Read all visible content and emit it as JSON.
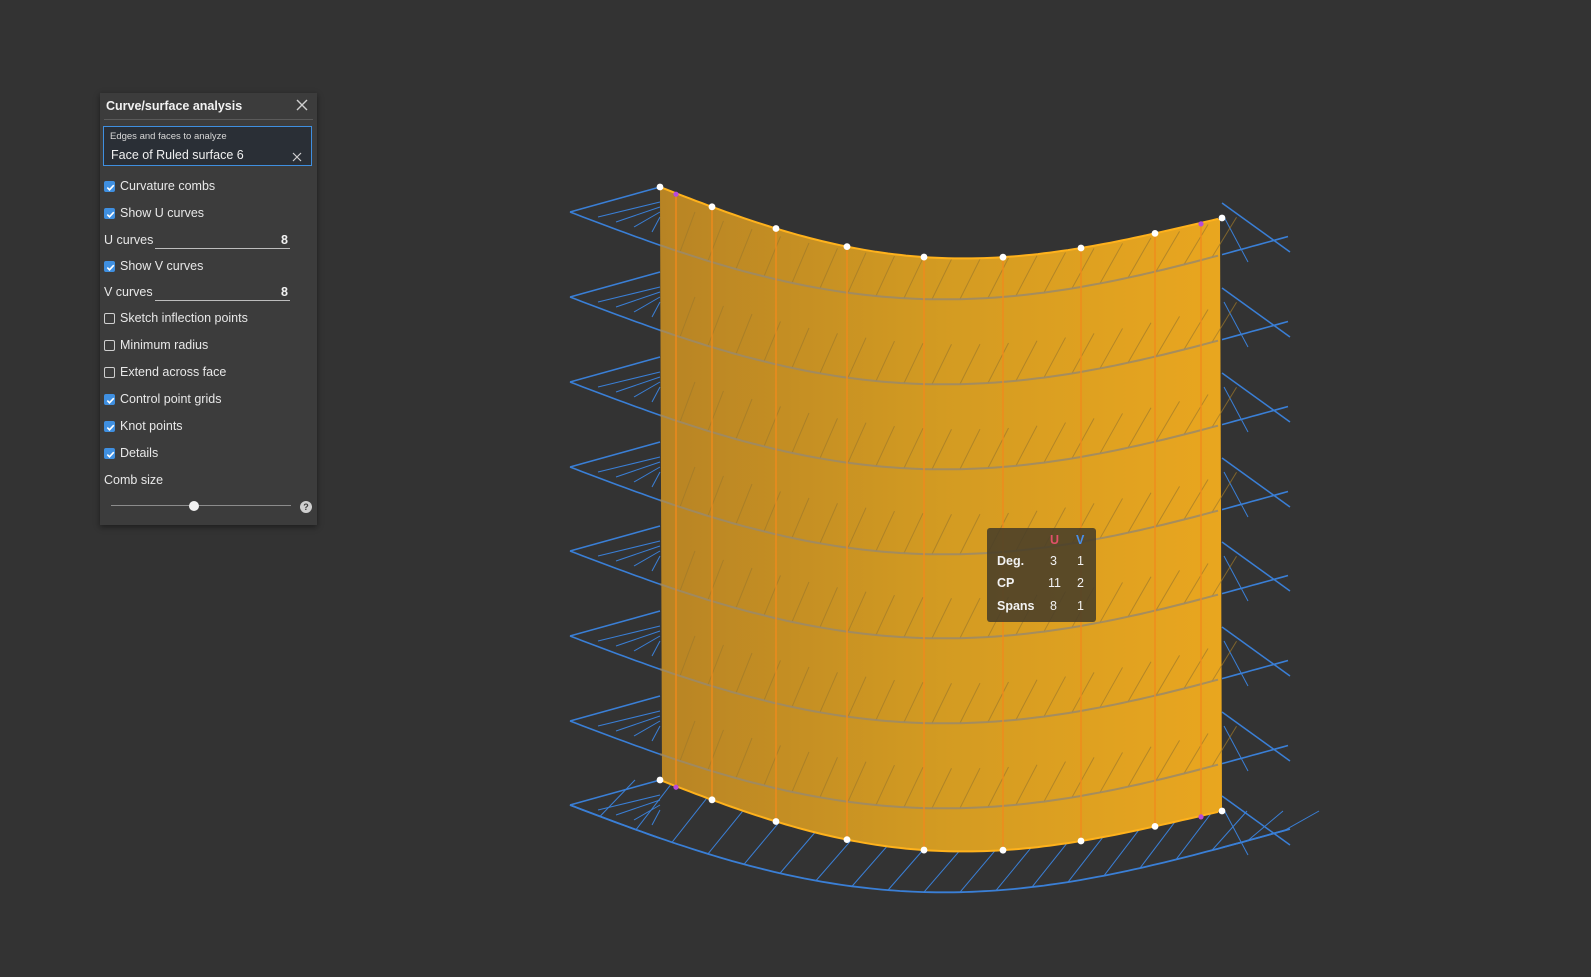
{
  "panel": {
    "title": "Curve/surface analysis",
    "selection": {
      "label": "Edges and faces to analyze",
      "value": "Face of Ruled surface 6"
    },
    "options": [
      {
        "label": "Curvature combs",
        "checked": true
      },
      {
        "label": "Show U curves",
        "checked": true
      },
      {
        "label": "Show V curves",
        "checked": true
      },
      {
        "label": "Sketch inflection points",
        "checked": false
      },
      {
        "label": "Minimum radius",
        "checked": false
      },
      {
        "label": "Extend across face",
        "checked": false
      },
      {
        "label": "Control point grids",
        "checked": true
      },
      {
        "label": "Knot points",
        "checked": true
      },
      {
        "label": "Details",
        "checked": true
      }
    ],
    "u_curves": {
      "label": "U curves",
      "value": "8"
    },
    "v_curves": {
      "label": "V curves",
      "value": "8"
    },
    "comb_size": {
      "label": "Comb size",
      "level": 0.46
    },
    "help_glyph": "?"
  },
  "details": {
    "headers": {
      "u": "U",
      "v": "V"
    },
    "rows": [
      {
        "label": "Deg.",
        "u": "3",
        "v": "1"
      },
      {
        "label": "CP",
        "u": "11",
        "v": "2"
      },
      {
        "label": "Spans",
        "u": "8",
        "v": "1"
      }
    ]
  },
  "colors": {
    "background": "#333333",
    "panel": "#3c3c3c",
    "accent": "#3f8fe0",
    "surface": "#e8a521",
    "comb_blue": "#3a7fd6",
    "u_label": "#e0506a",
    "v_label": "#4a8fe8"
  },
  "icons": [
    "close-icon",
    "clear-icon",
    "check-icon",
    "help-icon",
    "slider-thumb"
  ]
}
